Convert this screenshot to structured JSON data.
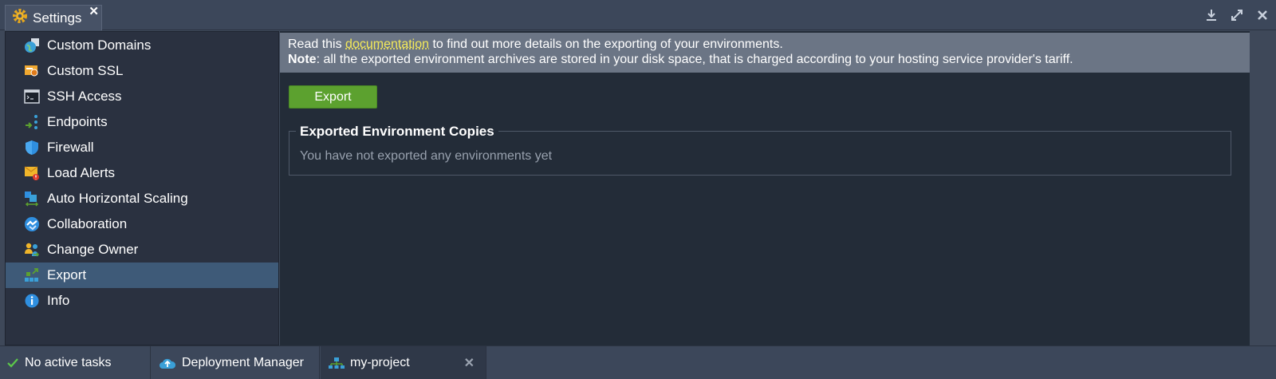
{
  "window": {
    "tab_title": "Settings",
    "tab_icon": "gear-icon",
    "tools": [
      "download-icon",
      "expand-icon",
      "close-icon"
    ]
  },
  "sidebar": {
    "items": [
      {
        "label": "Custom Domains",
        "icon": "globe-icon"
      },
      {
        "label": "Custom SSL",
        "icon": "certificate-icon"
      },
      {
        "label": "SSH Access",
        "icon": "terminal-icon"
      },
      {
        "label": "Endpoints",
        "icon": "endpoints-icon"
      },
      {
        "label": "Firewall",
        "icon": "shield-icon"
      },
      {
        "label": "Load Alerts",
        "icon": "alert-mail-icon"
      },
      {
        "label": "Auto Horizontal Scaling",
        "icon": "scaling-icon"
      },
      {
        "label": "Collaboration",
        "icon": "handshake-icon"
      },
      {
        "label": "Change Owner",
        "icon": "change-owner-icon"
      },
      {
        "label": "Export",
        "icon": "export-icon",
        "active": true
      },
      {
        "label": "Info",
        "icon": "info-icon"
      }
    ]
  },
  "main": {
    "notice": {
      "prefix": "Read this ",
      "link": "documentation",
      "suffix": " to find out more details on the exporting of your environments.",
      "note_label": "Note",
      "note_text": ": all the exported environment archives are stored in your disk space, that is charged according to your hosting service provider's tariff."
    },
    "export_button": "Export",
    "copies": {
      "title": "Exported Environment Copies",
      "empty": "You have not exported any environments yet"
    }
  },
  "taskbar": {
    "status": "No active tasks",
    "deployment_manager": "Deployment Manager",
    "project": "my-project"
  },
  "colors": {
    "accent_green": "#5ca12f",
    "active_item": "#3e5a78",
    "link": "#f3e95a"
  }
}
